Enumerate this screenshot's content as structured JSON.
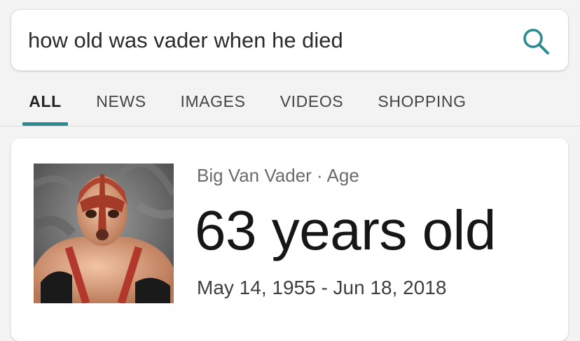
{
  "search": {
    "query": "how old was vader when he died",
    "icon": "search-icon"
  },
  "tabs": [
    {
      "label": "ALL",
      "active": true
    },
    {
      "label": "NEWS",
      "active": false
    },
    {
      "label": "IMAGES",
      "active": false
    },
    {
      "label": "VIDEOS",
      "active": false
    },
    {
      "label": "SHOPPING",
      "active": false
    }
  ],
  "answer_card": {
    "entity": "Big Van Vader",
    "separator": "·",
    "attribute": "Age",
    "answer": "63 years old",
    "date_range": "May 14, 1955 - Jun 18, 2018"
  },
  "colors": {
    "accent": "#2a8a8f",
    "background": "#f3f3f3",
    "card": "#ffffff"
  }
}
